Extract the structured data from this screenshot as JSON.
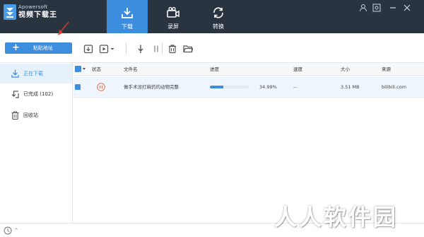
{
  "app": {
    "brand_en": "Apowersoft",
    "brand_cn": "视频下载王"
  },
  "tabs": [
    {
      "label": "下载",
      "icon": "download-icon",
      "active": true
    },
    {
      "label": "录屏",
      "icon": "video-camera-icon",
      "active": false
    },
    {
      "label": "转换",
      "icon": "convert-icon",
      "active": false
    }
  ],
  "window_controls": [
    "user-icon",
    "settings-icon",
    "minimize-icon",
    "close-icon"
  ],
  "toolbar": {
    "paste_plus": "+",
    "paste_label": "粘贴地址"
  },
  "sidebar": {
    "items": [
      {
        "label": "正在下载",
        "icon": "download-icon",
        "active": true
      },
      {
        "label": "已完成 (102)",
        "icon": "completed-icon",
        "active": false
      },
      {
        "label": "回收站",
        "icon": "trash-icon",
        "active": false
      }
    ]
  },
  "table": {
    "headers": {
      "status": "状态",
      "filename": "文件名",
      "progress": "进度",
      "speed": "速度",
      "size": "大小",
      "source": "来源"
    },
    "rows": [
      {
        "filename": "做手术没打麻药的动物完整",
        "progress": 0.3499,
        "progress_text": "34.99%",
        "speed": "--",
        "size": "3.51 MB",
        "source": "bilibili.com"
      }
    ]
  },
  "watermark": "人人软件园",
  "colors": {
    "topbar": "#2a3340",
    "accent": "#3d8ede",
    "pause": "#e8674a"
  }
}
